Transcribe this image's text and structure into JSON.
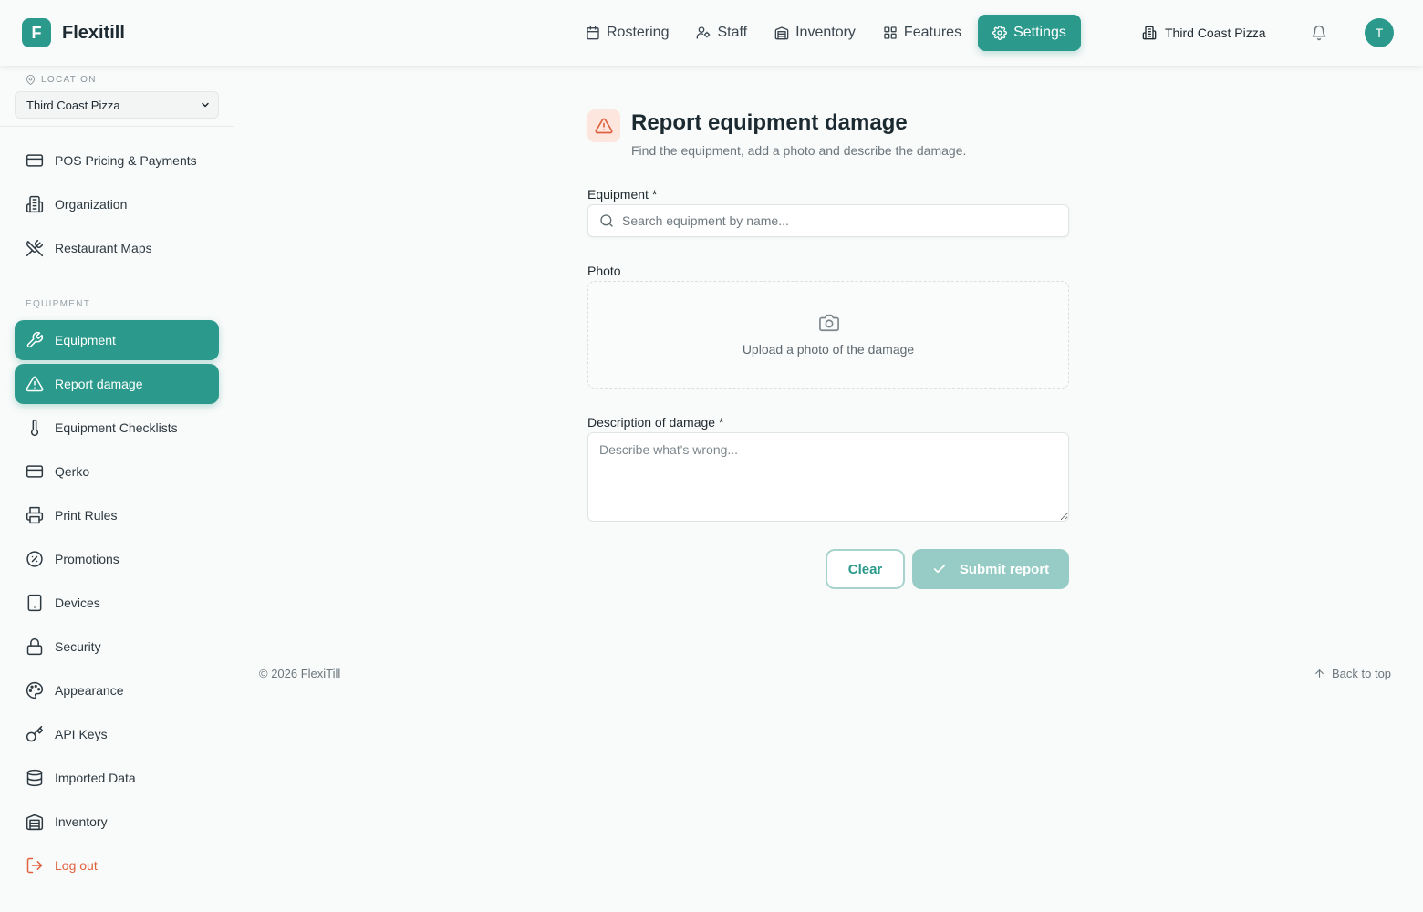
{
  "brand": {
    "logo_letter": "F",
    "name": "Flexitill"
  },
  "nav": {
    "items": [
      {
        "label": "Rostering",
        "icon": "calendar-icon"
      },
      {
        "label": "Staff",
        "icon": "users-icon"
      },
      {
        "label": "Inventory",
        "icon": "warehouse-icon"
      },
      {
        "label": "Features",
        "icon": "grid-icon"
      },
      {
        "label": "Settings",
        "icon": "gear-icon",
        "active": true
      }
    ],
    "location": "Third Coast Pizza",
    "avatar_initial": "T"
  },
  "sidebar": {
    "location_label": "LOCATION",
    "location_value": "Third Coast Pizza",
    "items_top": [
      {
        "label": "POS Pricing & Payments",
        "icon": "credit-card-icon"
      },
      {
        "label": "Organization",
        "icon": "building-icon"
      },
      {
        "label": "Restaurant Maps",
        "icon": "utensils-crossed-icon"
      }
    ],
    "equipment_section_label": "EQUIPMENT",
    "items_equipment": [
      {
        "label": "Equipment",
        "icon": "wrench-icon",
        "active": true
      },
      {
        "label": "Report damage",
        "icon": "warning-icon",
        "active": true
      },
      {
        "label": "Equipment Checklists",
        "icon": "thermometer-icon"
      },
      {
        "label": "Qerko",
        "icon": "card-icon"
      },
      {
        "label": "Print Rules",
        "icon": "printer-icon"
      },
      {
        "label": "Promotions",
        "icon": "percent-badge-icon"
      },
      {
        "label": "Devices",
        "icon": "tablet-icon"
      },
      {
        "label": "Security",
        "icon": "lock-icon"
      },
      {
        "label": "Appearance",
        "icon": "palette-icon"
      },
      {
        "label": "API Keys",
        "icon": "key-icon"
      },
      {
        "label": "Imported Data",
        "icon": "database-icon"
      },
      {
        "label": "Inventory",
        "icon": "warehouse-icon"
      }
    ],
    "logout_label": "Log out"
  },
  "form": {
    "title": "Report equipment damage",
    "subtitle": "Find the equipment, add a photo and describe the damage.",
    "equipment_label": "Equipment *",
    "equipment_placeholder": "Search equipment by name...",
    "photo_label": "Photo",
    "upload_text": "Upload a photo of the damage",
    "description_label": "Description of damage *",
    "description_placeholder": "Describe what's wrong...",
    "clear_label": "Clear",
    "submit_label": "Submit report"
  },
  "footer": {
    "copyright": "© 2026 FlexiTill",
    "back_to_top": "Back to top"
  },
  "colors": {
    "accent": "#2b9a8c",
    "accent_disabled": "#96ccc5",
    "warning": "#e0613f",
    "warning_bg": "#fde6dd"
  }
}
